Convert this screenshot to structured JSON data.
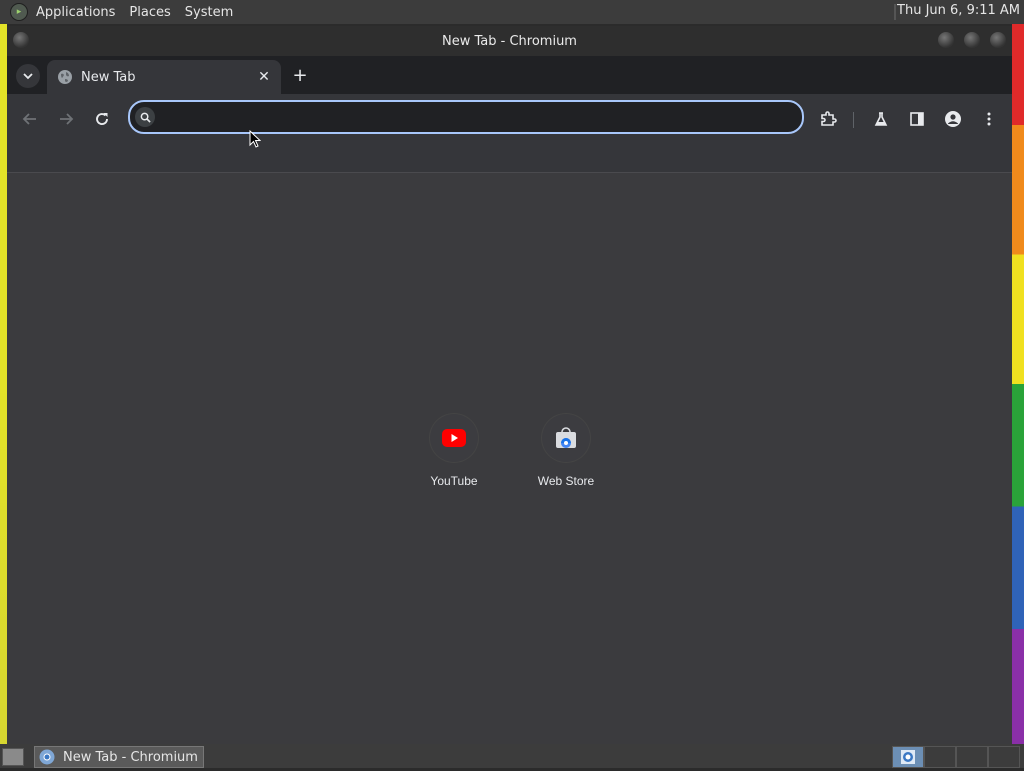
{
  "top_panel": {
    "menus": [
      "Applications",
      "Places",
      "System"
    ],
    "clock": "Thu Jun  6,  9:11 AM"
  },
  "window": {
    "title": "New Tab - Chromium"
  },
  "tabs": [
    {
      "label": "New Tab",
      "active": true
    }
  ],
  "omnibox": {
    "value": "",
    "placeholder": ""
  },
  "shortcuts": [
    {
      "label": "YouTube",
      "icon": "youtube-icon"
    },
    {
      "label": "Web Store",
      "icon": "web-store-icon"
    }
  ],
  "taskbar": {
    "task_label": "New Tab - Chromium"
  },
  "colors": {
    "accent_focus": "#a8c7fa",
    "tab_active": "#35363a",
    "page_bg": "#3b3b3e",
    "youtube_red": "#ff0000"
  }
}
